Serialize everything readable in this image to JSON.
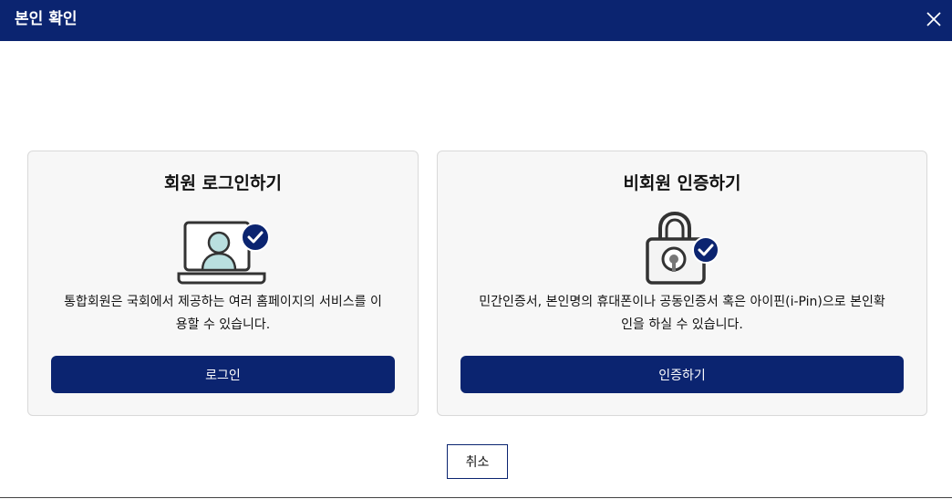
{
  "dialog": {
    "title": "본인 확인",
    "close_icon": "close-icon"
  },
  "member": {
    "heading": "회원 로그인하기",
    "icon": "laptop-user-check-icon",
    "desc_line1": "통합회원은 국회에서 제공하는 여러 홈페이지의 서비스를 이",
    "desc_line2": "용할 수 있습니다.",
    "button_label": "로그인"
  },
  "guest": {
    "heading": "비회원 인증하기",
    "icon": "padlock-check-icon",
    "desc_line1": "민간인증서, 본인명의 휴대폰이나 공동인증서 혹은 아이핀(i-Pin)으로 본인확",
    "desc_line2": "인을 하실 수 있습니다.",
    "button_label": "인증하기"
  },
  "footer": {
    "cancel_label": "취소"
  },
  "colors": {
    "primary": "#0b2470",
    "card_bg": "#f7f7f7",
    "card_border": "#d9d9d9",
    "avatar_fill": "#b9dfdf",
    "icon_stroke": "#333333"
  }
}
